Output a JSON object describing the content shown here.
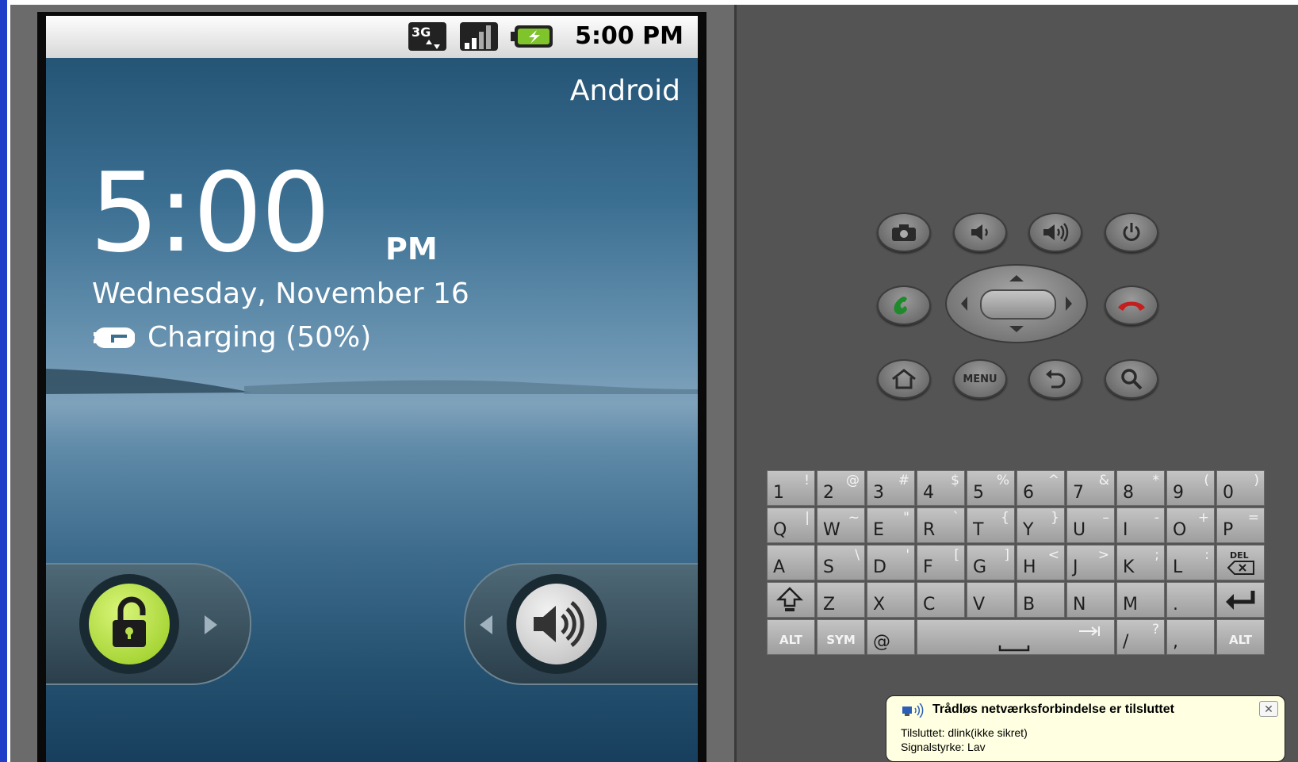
{
  "statusbar": {
    "network_type": "3G",
    "time": "5:00 PM",
    "icons": [
      "3g-data-icon",
      "signal-bars-icon",
      "battery-charging-icon"
    ]
  },
  "lockscreen": {
    "carrier": "Android",
    "clock_time": "5:00",
    "clock_ampm": "PM",
    "date": "Wednesday, November 16",
    "charging_text": "Charging (50%)",
    "unlock_icon": "padlock-open-icon",
    "sound_icon": "speaker-volume-icon"
  },
  "hardware_buttons": {
    "row1": [
      "camera-icon",
      "volume-down-icon",
      "volume-up-icon",
      "power-icon"
    ],
    "row2": [
      "call-icon",
      "dpad",
      "end-call-icon"
    ],
    "row3": [
      "home-icon",
      "menu",
      "back-icon",
      "search-icon"
    ],
    "menu_label": "MENU"
  },
  "keyboard": {
    "row1": [
      [
        "1",
        "!"
      ],
      [
        "2",
        "@"
      ],
      [
        "3",
        "#"
      ],
      [
        "4",
        "$"
      ],
      [
        "5",
        "%"
      ],
      [
        "6",
        "^"
      ],
      [
        "7",
        "&"
      ],
      [
        "8",
        "*"
      ],
      [
        "9",
        "("
      ],
      [
        "0",
        ")"
      ]
    ],
    "row2": [
      [
        "Q",
        "|"
      ],
      [
        "W",
        "~"
      ],
      [
        "E",
        "\""
      ],
      [
        "R",
        "`"
      ],
      [
        "T",
        "{"
      ],
      [
        "Y",
        "}"
      ],
      [
        "U",
        "–"
      ],
      [
        "I",
        "-"
      ],
      [
        "O",
        "+"
      ],
      [
        "P",
        "="
      ]
    ],
    "row3": [
      [
        "A",
        ""
      ],
      [
        "S",
        "\\"
      ],
      [
        "D",
        "'"
      ],
      [
        "F",
        "["
      ],
      [
        "G",
        "]"
      ],
      [
        "H",
        "<"
      ],
      [
        "J",
        ">"
      ],
      [
        "K",
        ";"
      ],
      [
        "L",
        ":"
      ]
    ],
    "del_label": "DEL",
    "row4": [
      "Z",
      "X",
      "C",
      "V",
      "B",
      "N",
      "M",
      "."
    ],
    "alt_label": "ALT",
    "sym_label": "SYM",
    "at_label": "@",
    "slash_main": "/",
    "slash_alt": "?",
    "comma": ","
  },
  "notification": {
    "title": "Trådløs netværksforbindelse er tilsluttet",
    "line1": "Tilsluttet: dlink(ikke sikret)",
    "line2": "Signalstyrke: Lav",
    "close": "✕"
  }
}
